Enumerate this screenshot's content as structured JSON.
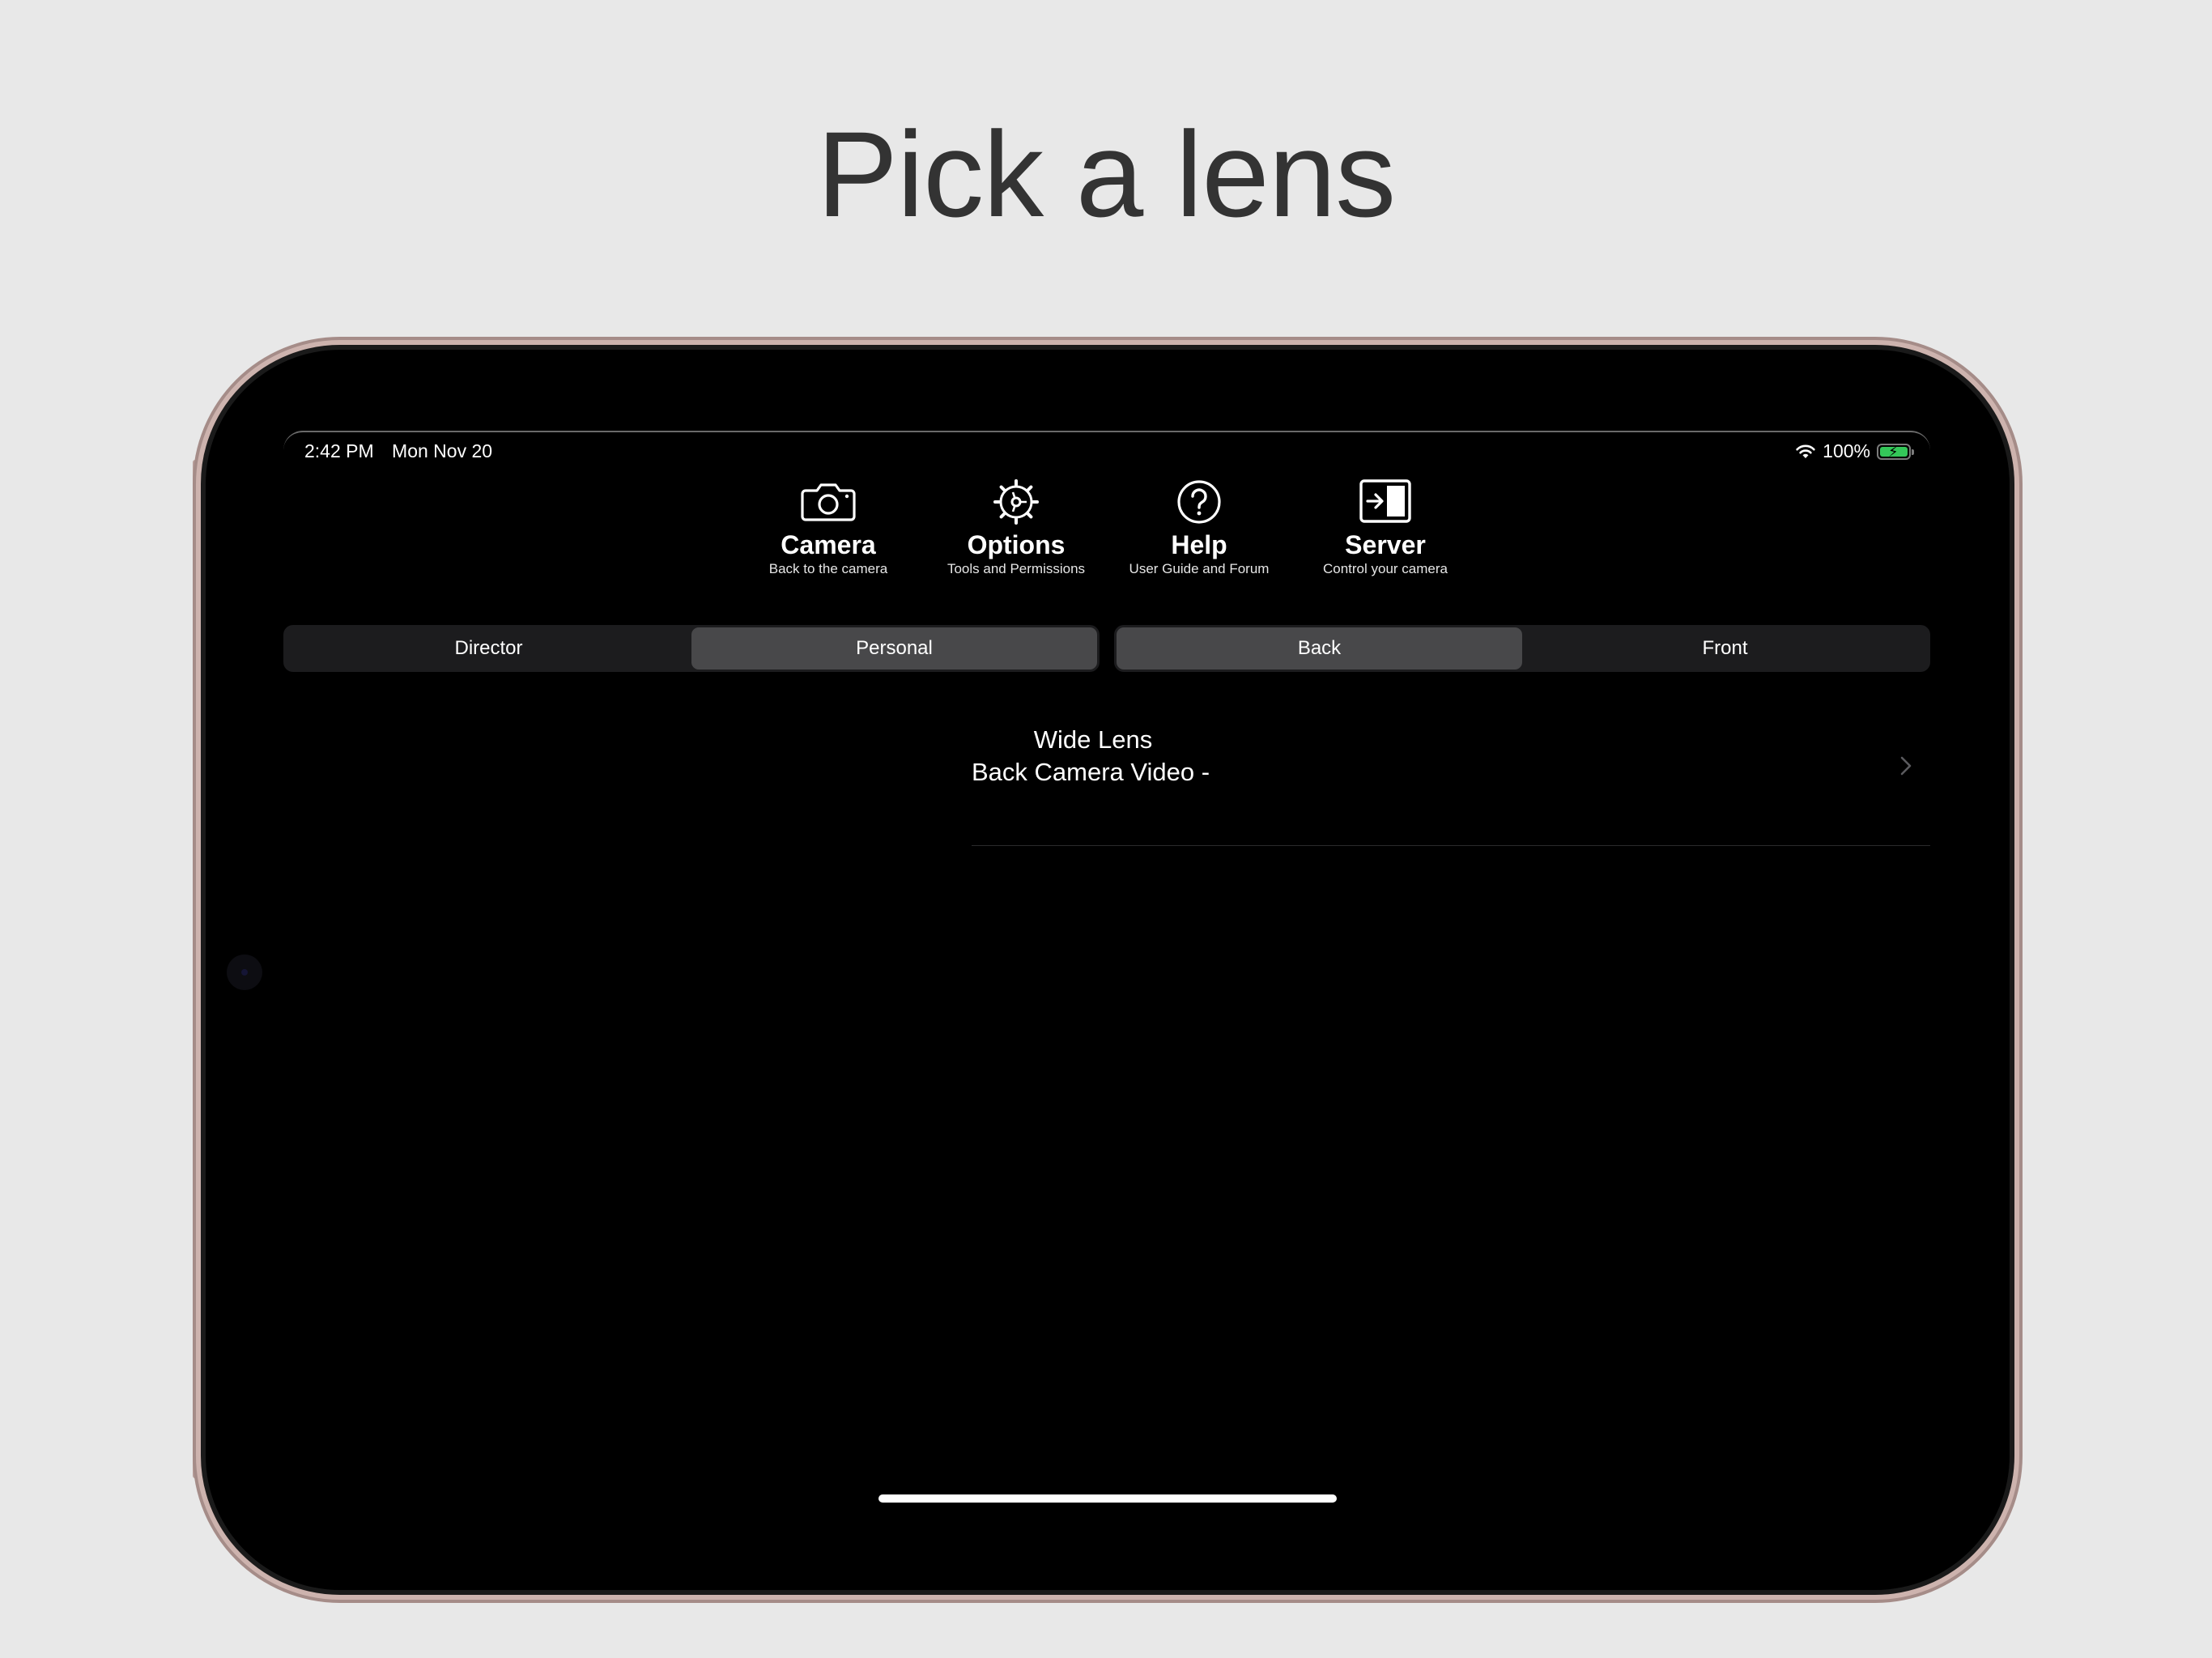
{
  "headline": "Pick a lens",
  "status_bar": {
    "time": "2:42 PM",
    "date": "Mon Nov 20",
    "battery_percent": "100%",
    "battery_level": 1.0,
    "charging": true
  },
  "toolbar": {
    "items": [
      {
        "label": "Camera",
        "subtitle": "Back to the camera",
        "icon": "camera-icon"
      },
      {
        "label": "Options",
        "subtitle": "Tools and Permissions",
        "icon": "gear-icon"
      },
      {
        "label": "Help",
        "subtitle": "User Guide and Forum",
        "icon": "question-icon"
      },
      {
        "label": "Server",
        "subtitle": "Control your camera",
        "icon": "sidebar-enter-icon"
      }
    ]
  },
  "mode_segment": {
    "options": [
      "Director",
      "Personal"
    ],
    "selected": "Personal"
  },
  "camera_segment": {
    "options": [
      "Back",
      "Front"
    ],
    "selected": "Back"
  },
  "lens_list": {
    "items": [
      {
        "title": "Wide Lens",
        "subtitle": "Back Camera Video -"
      }
    ]
  },
  "colors": {
    "page_background": "#e8e8e8",
    "headline": "#333333",
    "device_frame": "#cdb3ae",
    "screen_background": "#000000",
    "segment_background": "#1c1c1e",
    "segment_selected": "#48484a",
    "battery_green": "#34c759"
  }
}
